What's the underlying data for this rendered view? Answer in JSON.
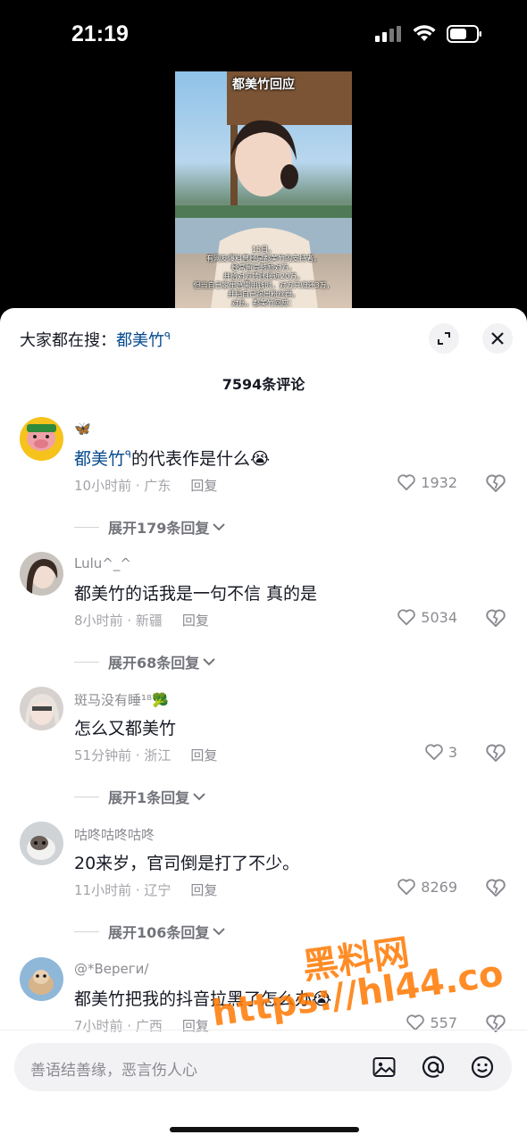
{
  "status_bar": {
    "time": "21:19"
  },
  "video": {
    "title": "都美竹回应",
    "caption_lines": [
      "15日，",
      "有网友爆料曾经是都美竹的支持者，",
      "经常留言鼓励对方，",
      "并给对方转账接近20万。",
      "但当自己家里急需用钱时，对方只归还3万，",
      "并把自己踢出粉丝群。",
      "对此，都美竹回应："
    ]
  },
  "sheet": {
    "search_prefix": "大家都在搜：",
    "search_keyword": "都美竹",
    "comment_count": "7594条评论"
  },
  "comments": [
    {
      "username": "🦋",
      "text_keyword": "都美竹",
      "text_rest": "的代表作是什么😭",
      "time_location": "10小时前 · 广东",
      "reply": "回复",
      "likes": "1932",
      "expand": "展开179条回复"
    },
    {
      "username": "Lulu^_^",
      "text": "都美竹的话我是一句不信 真的是",
      "time_location": "8小时前 · 新疆",
      "reply": "回复",
      "likes": "5034",
      "expand": "展开68条回复"
    },
    {
      "username": "斑马没有睡¹⁸🥦",
      "text": "怎么又都美竹",
      "time_location": "51分钟前 · 浙江",
      "reply": "回复",
      "likes": "3",
      "expand": "展开1条回复"
    },
    {
      "username": "咕咚咕咚咕咚",
      "text": "20来岁，官司倒是打了不少。",
      "time_location": "11小时前 · 辽宁",
      "reply": "回复",
      "likes": "8269",
      "expand": "展开106条回复"
    },
    {
      "username": "@*Вереги/",
      "text": "都美竹把我的抖音拉黑了怎么办😭",
      "time_location": "7小时前 · 广西",
      "reply": "回复",
      "likes": "557"
    }
  ],
  "watermark": {
    "line1": "黑料网",
    "line2": "https://hl44.co"
  },
  "input": {
    "placeholder": "善语结善缘，恶言伤人心"
  },
  "colors": {
    "keyword": "#04498d",
    "watermark": "#ff7800"
  }
}
